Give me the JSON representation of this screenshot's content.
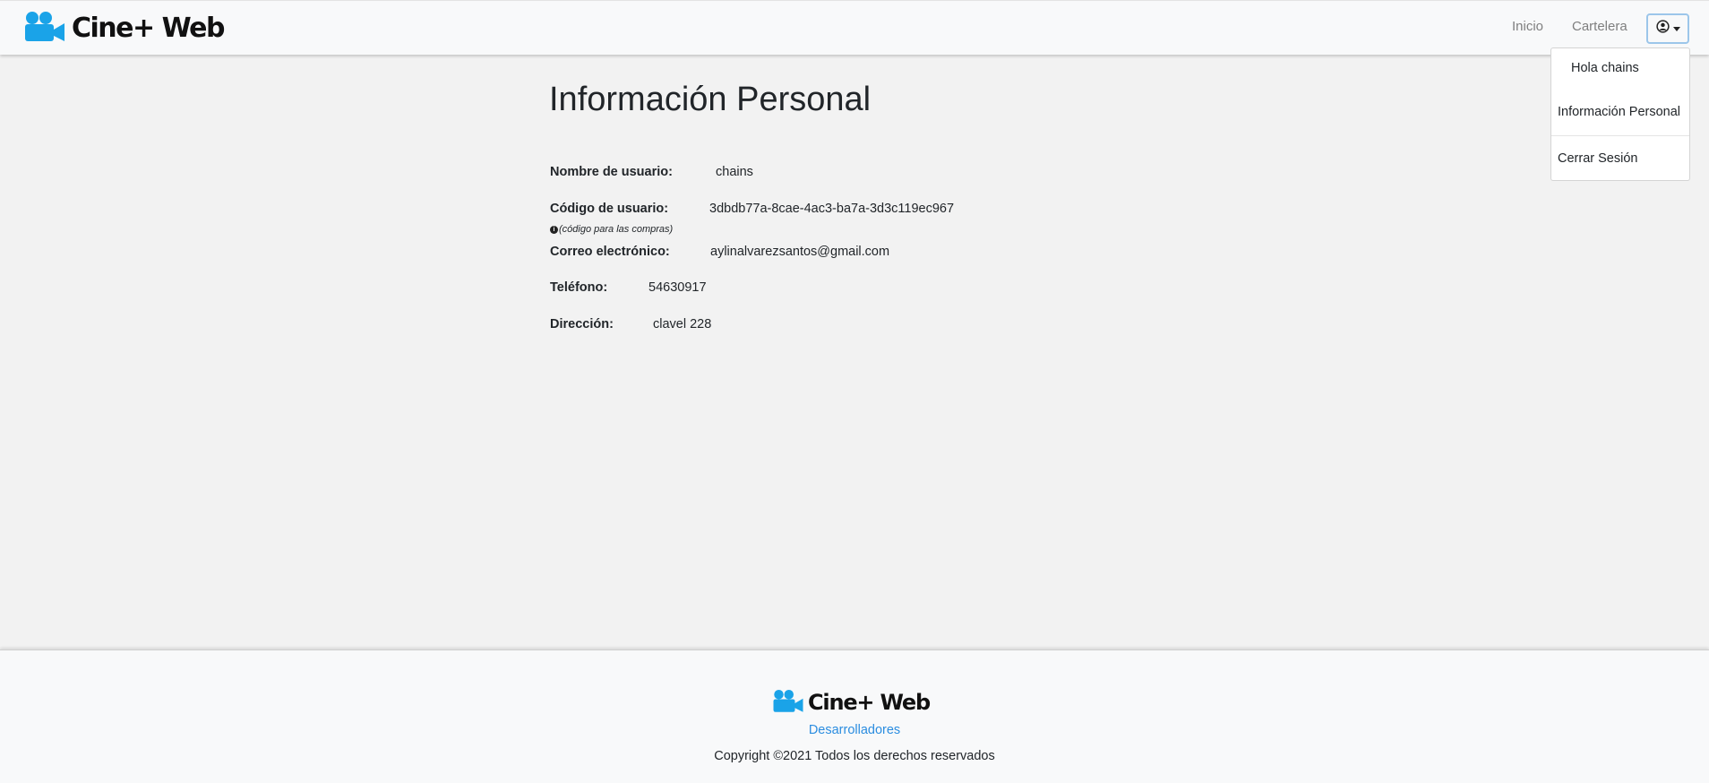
{
  "brand": {
    "name": "Cine+ Web",
    "icon": "video-camera-icon",
    "color": "#1aa3e8"
  },
  "navbar": {
    "links": [
      "Inicio",
      "Cartelera"
    ],
    "user_icon": "user-circle-icon"
  },
  "dropdown": {
    "greeting": "Hola chains",
    "info": "Información Personal",
    "logout": "Cerrar Sesión"
  },
  "main": {
    "title": "Información Personal",
    "fields": {
      "username": {
        "label": "Nombre de usuario:",
        "value": "chains"
      },
      "user_code": {
        "label": "Código de usuario:",
        "value": "3dbdb77a-8cae-4ac3-ba7a-3d3c119ec967",
        "hint": "(código para las compras)"
      },
      "email": {
        "label": "Correo electrónico:",
        "value": "aylinalvarezsantos@gmail.com"
      },
      "phone": {
        "label": "Teléfono:",
        "value": "54630917"
      },
      "address": {
        "label": "Dirección:",
        "value": "clavel 228"
      }
    }
  },
  "footer": {
    "brand": "Cine+ Web",
    "developers_link": "Desarrolladores",
    "copyright": "Copyright ©2021 Todos los derechos reservados",
    "link_color": "#2b8de0"
  }
}
